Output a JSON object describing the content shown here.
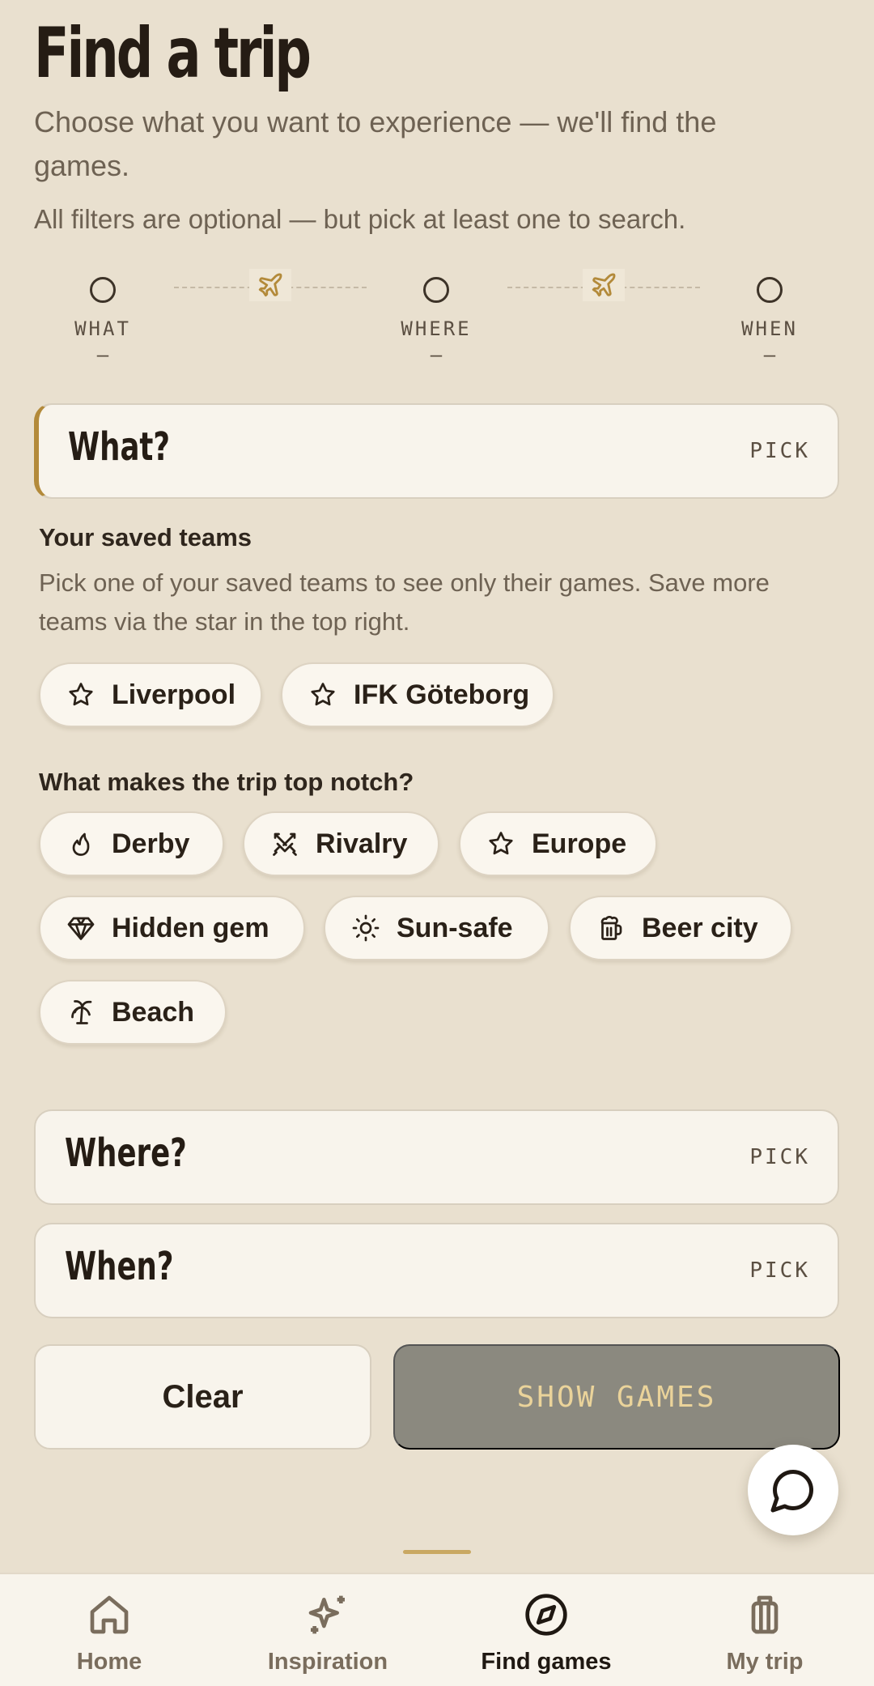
{
  "header": {
    "title": "Find a trip",
    "subtitle": "Choose what you want to experience — we'll find the games.",
    "hint": "All filters are optional — but pick at least one to search."
  },
  "stepper": {
    "steps": [
      {
        "label": "WHAT",
        "value": "–"
      },
      {
        "label": "WHERE",
        "value": "–"
      },
      {
        "label": "WHEN",
        "value": "–"
      }
    ]
  },
  "what_card": {
    "title": "What?",
    "action": "PICK"
  },
  "saved_teams": {
    "heading": "Your saved teams",
    "description": "Pick one of your saved teams to see only their games. Save more teams via the star in the top right.",
    "teams": [
      {
        "label": "Liverpool",
        "icon": "star-icon"
      },
      {
        "label": "IFK Göteborg",
        "icon": "star-icon"
      }
    ]
  },
  "top_notch": {
    "heading": "What makes the trip top notch?",
    "tags": [
      {
        "label": "Derby",
        "icon": "flame-icon"
      },
      {
        "label": "Rivalry",
        "icon": "crossed-swords-icon"
      },
      {
        "label": "Europe",
        "icon": "star-icon"
      },
      {
        "label": "Hidden gem",
        "icon": "gem-icon"
      },
      {
        "label": "Sun-safe",
        "icon": "sun-icon"
      },
      {
        "label": "Beer city",
        "icon": "beer-mug-icon"
      },
      {
        "label": "Beach",
        "icon": "palm-tree-icon"
      }
    ]
  },
  "where_card": {
    "title": "Where?",
    "action": "PICK"
  },
  "when_card": {
    "title": "When?",
    "action": "PICK"
  },
  "actions": {
    "clear_label": "Clear",
    "show_label": "SHOW GAMES"
  },
  "colors": {
    "background": "#e9e0cf",
    "accent": "#b38a3a",
    "disabled_button": "#8b897f"
  },
  "nav": {
    "items": [
      {
        "label": "Home",
        "icon": "home-icon"
      },
      {
        "label": "Inspiration",
        "icon": "sparkles-icon"
      },
      {
        "label": "Find games",
        "icon": "compass-icon",
        "active": true
      },
      {
        "label": "My trip",
        "icon": "luggage-icon"
      }
    ]
  }
}
